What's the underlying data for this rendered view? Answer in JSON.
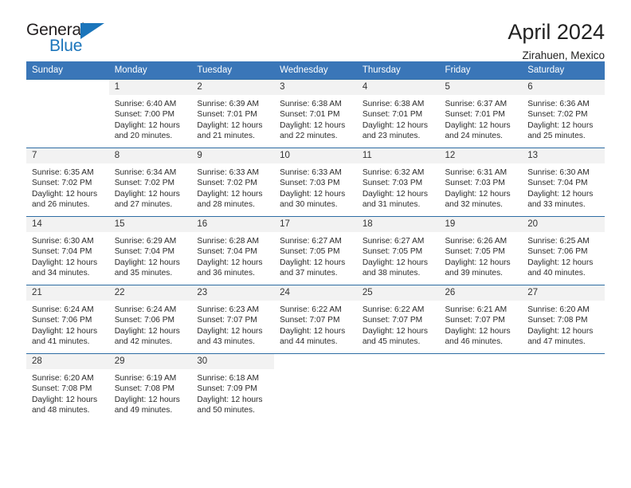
{
  "brand": {
    "name_top": "General",
    "name_bottom": "Blue",
    "accent_color": "#1b75bb"
  },
  "header": {
    "title": "April 2024",
    "subtitle": "Zirahuen, Mexico"
  },
  "theme": {
    "header_row_bg": "#3a76b8",
    "daynum_bg": "#f2f2f2",
    "grid_line": "#2e6da4",
    "text_color": "#2b2b2b"
  },
  "weekday_headers": [
    "Sunday",
    "Monday",
    "Tuesday",
    "Wednesday",
    "Thursday",
    "Friday",
    "Saturday"
  ],
  "labels": {
    "sunrise_prefix": "Sunrise:",
    "sunset_prefix": "Sunset:",
    "daylight_prefix": "Daylight:"
  },
  "weeks": [
    [
      {
        "day": "",
        "sunrise": "",
        "sunset": "",
        "daylight_line1": "",
        "daylight_line2": ""
      },
      {
        "day": "1",
        "sunrise": "Sunrise: 6:40 AM",
        "sunset": "Sunset: 7:00 PM",
        "daylight_line1": "Daylight: 12 hours",
        "daylight_line2": "and 20 minutes."
      },
      {
        "day": "2",
        "sunrise": "Sunrise: 6:39 AM",
        "sunset": "Sunset: 7:01 PM",
        "daylight_line1": "Daylight: 12 hours",
        "daylight_line2": "and 21 minutes."
      },
      {
        "day": "3",
        "sunrise": "Sunrise: 6:38 AM",
        "sunset": "Sunset: 7:01 PM",
        "daylight_line1": "Daylight: 12 hours",
        "daylight_line2": "and 22 minutes."
      },
      {
        "day": "4",
        "sunrise": "Sunrise: 6:38 AM",
        "sunset": "Sunset: 7:01 PM",
        "daylight_line1": "Daylight: 12 hours",
        "daylight_line2": "and 23 minutes."
      },
      {
        "day": "5",
        "sunrise": "Sunrise: 6:37 AM",
        "sunset": "Sunset: 7:01 PM",
        "daylight_line1": "Daylight: 12 hours",
        "daylight_line2": "and 24 minutes."
      },
      {
        "day": "6",
        "sunrise": "Sunrise: 6:36 AM",
        "sunset": "Sunset: 7:02 PM",
        "daylight_line1": "Daylight: 12 hours",
        "daylight_line2": "and 25 minutes."
      }
    ],
    [
      {
        "day": "7",
        "sunrise": "Sunrise: 6:35 AM",
        "sunset": "Sunset: 7:02 PM",
        "daylight_line1": "Daylight: 12 hours",
        "daylight_line2": "and 26 minutes."
      },
      {
        "day": "8",
        "sunrise": "Sunrise: 6:34 AM",
        "sunset": "Sunset: 7:02 PM",
        "daylight_line1": "Daylight: 12 hours",
        "daylight_line2": "and 27 minutes."
      },
      {
        "day": "9",
        "sunrise": "Sunrise: 6:33 AM",
        "sunset": "Sunset: 7:02 PM",
        "daylight_line1": "Daylight: 12 hours",
        "daylight_line2": "and 28 minutes."
      },
      {
        "day": "10",
        "sunrise": "Sunrise: 6:33 AM",
        "sunset": "Sunset: 7:03 PM",
        "daylight_line1": "Daylight: 12 hours",
        "daylight_line2": "and 30 minutes."
      },
      {
        "day": "11",
        "sunrise": "Sunrise: 6:32 AM",
        "sunset": "Sunset: 7:03 PM",
        "daylight_line1": "Daylight: 12 hours",
        "daylight_line2": "and 31 minutes."
      },
      {
        "day": "12",
        "sunrise": "Sunrise: 6:31 AM",
        "sunset": "Sunset: 7:03 PM",
        "daylight_line1": "Daylight: 12 hours",
        "daylight_line2": "and 32 minutes."
      },
      {
        "day": "13",
        "sunrise": "Sunrise: 6:30 AM",
        "sunset": "Sunset: 7:04 PM",
        "daylight_line1": "Daylight: 12 hours",
        "daylight_line2": "and 33 minutes."
      }
    ],
    [
      {
        "day": "14",
        "sunrise": "Sunrise: 6:30 AM",
        "sunset": "Sunset: 7:04 PM",
        "daylight_line1": "Daylight: 12 hours",
        "daylight_line2": "and 34 minutes."
      },
      {
        "day": "15",
        "sunrise": "Sunrise: 6:29 AM",
        "sunset": "Sunset: 7:04 PM",
        "daylight_line1": "Daylight: 12 hours",
        "daylight_line2": "and 35 minutes."
      },
      {
        "day": "16",
        "sunrise": "Sunrise: 6:28 AM",
        "sunset": "Sunset: 7:04 PM",
        "daylight_line1": "Daylight: 12 hours",
        "daylight_line2": "and 36 minutes."
      },
      {
        "day": "17",
        "sunrise": "Sunrise: 6:27 AM",
        "sunset": "Sunset: 7:05 PM",
        "daylight_line1": "Daylight: 12 hours",
        "daylight_line2": "and 37 minutes."
      },
      {
        "day": "18",
        "sunrise": "Sunrise: 6:27 AM",
        "sunset": "Sunset: 7:05 PM",
        "daylight_line1": "Daylight: 12 hours",
        "daylight_line2": "and 38 minutes."
      },
      {
        "day": "19",
        "sunrise": "Sunrise: 6:26 AM",
        "sunset": "Sunset: 7:05 PM",
        "daylight_line1": "Daylight: 12 hours",
        "daylight_line2": "and 39 minutes."
      },
      {
        "day": "20",
        "sunrise": "Sunrise: 6:25 AM",
        "sunset": "Sunset: 7:06 PM",
        "daylight_line1": "Daylight: 12 hours",
        "daylight_line2": "and 40 minutes."
      }
    ],
    [
      {
        "day": "21",
        "sunrise": "Sunrise: 6:24 AM",
        "sunset": "Sunset: 7:06 PM",
        "daylight_line1": "Daylight: 12 hours",
        "daylight_line2": "and 41 minutes."
      },
      {
        "day": "22",
        "sunrise": "Sunrise: 6:24 AM",
        "sunset": "Sunset: 7:06 PM",
        "daylight_line1": "Daylight: 12 hours",
        "daylight_line2": "and 42 minutes."
      },
      {
        "day": "23",
        "sunrise": "Sunrise: 6:23 AM",
        "sunset": "Sunset: 7:07 PM",
        "daylight_line1": "Daylight: 12 hours",
        "daylight_line2": "and 43 minutes."
      },
      {
        "day": "24",
        "sunrise": "Sunrise: 6:22 AM",
        "sunset": "Sunset: 7:07 PM",
        "daylight_line1": "Daylight: 12 hours",
        "daylight_line2": "and 44 minutes."
      },
      {
        "day": "25",
        "sunrise": "Sunrise: 6:22 AM",
        "sunset": "Sunset: 7:07 PM",
        "daylight_line1": "Daylight: 12 hours",
        "daylight_line2": "and 45 minutes."
      },
      {
        "day": "26",
        "sunrise": "Sunrise: 6:21 AM",
        "sunset": "Sunset: 7:07 PM",
        "daylight_line1": "Daylight: 12 hours",
        "daylight_line2": "and 46 minutes."
      },
      {
        "day": "27",
        "sunrise": "Sunrise: 6:20 AM",
        "sunset": "Sunset: 7:08 PM",
        "daylight_line1": "Daylight: 12 hours",
        "daylight_line2": "and 47 minutes."
      }
    ],
    [
      {
        "day": "28",
        "sunrise": "Sunrise: 6:20 AM",
        "sunset": "Sunset: 7:08 PM",
        "daylight_line1": "Daylight: 12 hours",
        "daylight_line2": "and 48 minutes."
      },
      {
        "day": "29",
        "sunrise": "Sunrise: 6:19 AM",
        "sunset": "Sunset: 7:08 PM",
        "daylight_line1": "Daylight: 12 hours",
        "daylight_line2": "and 49 minutes."
      },
      {
        "day": "30",
        "sunrise": "Sunrise: 6:18 AM",
        "sunset": "Sunset: 7:09 PM",
        "daylight_line1": "Daylight: 12 hours",
        "daylight_line2": "and 50 minutes."
      },
      {
        "day": "",
        "sunrise": "",
        "sunset": "",
        "daylight_line1": "",
        "daylight_line2": ""
      },
      {
        "day": "",
        "sunrise": "",
        "sunset": "",
        "daylight_line1": "",
        "daylight_line2": ""
      },
      {
        "day": "",
        "sunrise": "",
        "sunset": "",
        "daylight_line1": "",
        "daylight_line2": ""
      },
      {
        "day": "",
        "sunrise": "",
        "sunset": "",
        "daylight_line1": "",
        "daylight_line2": ""
      }
    ]
  ]
}
